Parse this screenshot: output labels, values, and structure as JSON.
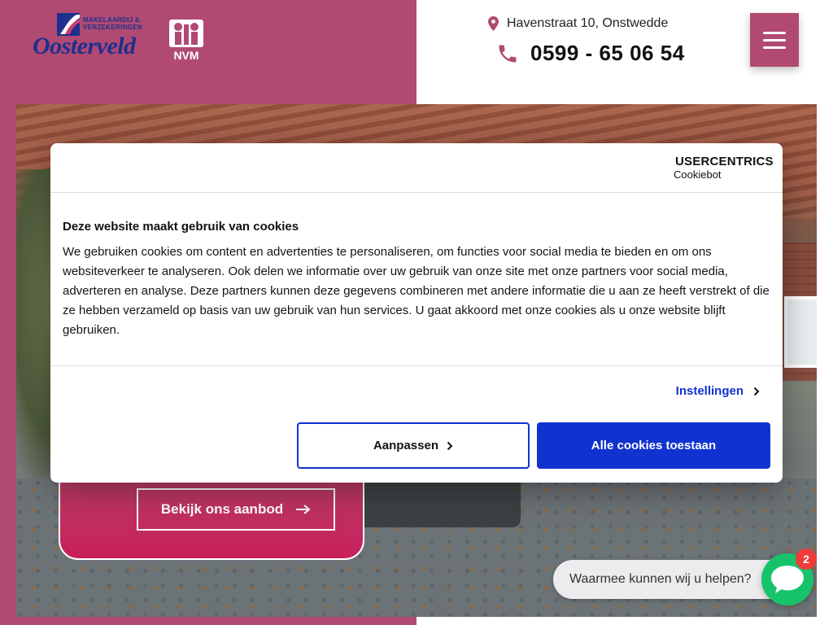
{
  "header": {
    "logo": {
      "tagline_line1": "MAKELAARDIJ &",
      "tagline_line2": "VERZEKERINGEN",
      "name": "Oosterveld"
    },
    "nvm_label": "NVM",
    "address": "Havenstraat 10, Onstwedde",
    "phone": "0599 - 65 06 54",
    "icons": {
      "address": "map-pin-icon",
      "phone": "phone-icon",
      "menu": "hamburger-menu-icon"
    }
  },
  "hero": {
    "offer_button_label": "Bekijk ons aanbod"
  },
  "cookie_dialog": {
    "brand_line1": "USERCENTRICS",
    "brand_line2": "Cookiebot",
    "title": "Deze website maakt gebruik van cookies",
    "body": "We gebruiken cookies om content en advertenties te personaliseren, om functies voor social media te bieden en om ons websiteverkeer te analyseren. Ook delen we informatie over uw gebruik van onze site met onze partners voor social media, adverteren en analyse. Deze partners kunnen deze gegevens combineren met andere informatie die u aan ze heeft verstrekt of die ze hebben verzameld op basis van uw gebruik van hun services. U gaat akkoord met onze cookies als u onze website blijft gebruiken.",
    "settings_label": "Instellingen",
    "customize_label": "Aanpassen",
    "accept_label": "Alle cookies toestaan"
  },
  "chat": {
    "prompt": "Waarmee kunnen wij u helpen?",
    "badge_count": "2"
  },
  "colors": {
    "brand_magenta": "#b04a72",
    "brand_blue": "#1f2f8f",
    "cookie_blue": "#1032cf",
    "chat_green": "#17c36a",
    "badge_red": "#ef3b3b"
  }
}
